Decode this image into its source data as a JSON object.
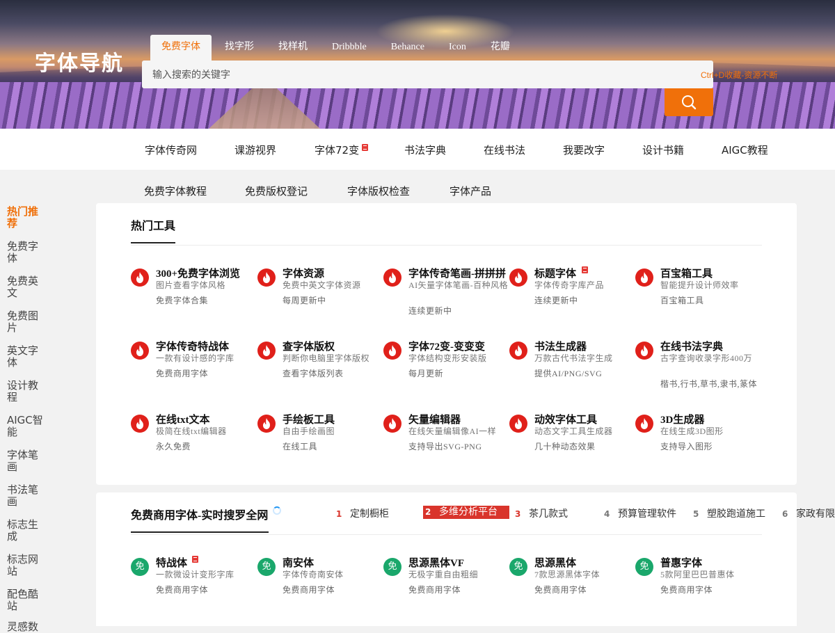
{
  "logo": "字体导航",
  "tabs": [
    "免费字体",
    "找字形",
    "找样机",
    "Dribbble",
    "Behance",
    "Icon",
    "花瓣"
  ],
  "search": {
    "placeholder": "输入搜索的关键字",
    "hint": "Ctrl+D收藏-资源不断"
  },
  "nav_row1": [
    "字体传奇网",
    "课游视界",
    "字体72变",
    "书法字典",
    "在线书法",
    "我要改字",
    "设计书籍",
    "AIGC教程"
  ],
  "nav_row2": [
    "免费字体教程",
    "免费版权登记",
    "字体版权检查",
    "字体产品"
  ],
  "sidebar": [
    "热门推荐",
    "免费字体",
    "免费英文",
    "免费图片",
    "英文字体",
    "设计教程",
    "AIGC智能",
    "字体笔画",
    "书法笔画",
    "标志生成",
    "标志网站",
    "配色酷站",
    "灵感数"
  ],
  "hot_tools": {
    "title": "热门工具",
    "cards": [
      {
        "title": "300+免费字体浏览",
        "d1": "图片查看字体风格",
        "d2": "免费字体合集"
      },
      {
        "title": "字体资源",
        "d1": "免费中英文字体资源",
        "d2": "每周更新中"
      },
      {
        "title": "字体传奇笔画-拼拼拼",
        "d1": "AI矢量字体笔画-百种风格",
        "d2": "连续更新中"
      },
      {
        "title": "标题字体",
        "d1": "字体传奇字库产品",
        "d2": "连续更新中"
      },
      {
        "title": "百宝箱工具",
        "d1": "智能提升设计师效率",
        "d2": "百宝箱工具"
      },
      {
        "title": "字体传奇特战体",
        "d1": "一款有设计感的字库",
        "d2": "免费商用字体"
      },
      {
        "title": "查字体版权",
        "d1": "判断你电脑里字体版权",
        "d2": "查看字体版列表"
      },
      {
        "title": "字体72变-变变变",
        "d1": "字体结构变形安装版",
        "d2": "每月更新"
      },
      {
        "title": "书法生成器",
        "d1": "万款古代书法字生成",
        "d2": "提供AI/PNG/SVG"
      },
      {
        "title": "在线书法字典",
        "d1": "古字查询收录字形400万",
        "d2": "楷书,行书,草书,隶书,篆体"
      },
      {
        "title": "在线txt文本",
        "d1": "极简在线txt编辑器",
        "d2": "永久免费"
      },
      {
        "title": "手绘板工具",
        "d1": "自由手绘画图",
        "d2": "在线工具"
      },
      {
        "title": "矢量编辑器",
        "d1": "在线矢量编辑像AI一样",
        "d2": "支持导出SVG-PNG"
      },
      {
        "title": "动效字体工具",
        "d1": "动态文字工具生成器",
        "d2": "几十种动态效果"
      },
      {
        "title": "3D生成器",
        "d1": "在线生成3D图形",
        "d2": "支持导入图形"
      }
    ]
  },
  "free_fonts": {
    "title": "免费商用字体-实时搜罗全网",
    "ranks": [
      {
        "n": "1",
        "label": "定制橱柜"
      },
      {
        "n": "2",
        "label": "多维分析平台"
      },
      {
        "n": "3",
        "label": "茶几款式"
      },
      {
        "n": "4",
        "label": "预算管理软件"
      },
      {
        "n": "5",
        "label": "塑胶跑道施工"
      },
      {
        "n": "6",
        "label": "家政有限公"
      }
    ],
    "badge": "免",
    "cards": [
      {
        "title": "特战体",
        "d1": "一款微设计变形字库",
        "d2": "免费商用字体"
      },
      {
        "title": "南安体",
        "d1": "字体传奇南安体",
        "d2": "免费商用字体"
      },
      {
        "title": "思源黑体VF",
        "d1": "无极字重自由粗细",
        "d2": "免费商用字体"
      },
      {
        "title": "思源黑体",
        "d1": "7款思源黑体字体",
        "d2": "免费商用字体"
      },
      {
        "title": "普惠字体",
        "d1": "5款阿里巴巴普惠体",
        "d2": "免费商用字体"
      }
    ]
  },
  "colors": {
    "accent": "#f0700a",
    "hot_red": "#e0201a",
    "free_green": "#1aa76b"
  }
}
